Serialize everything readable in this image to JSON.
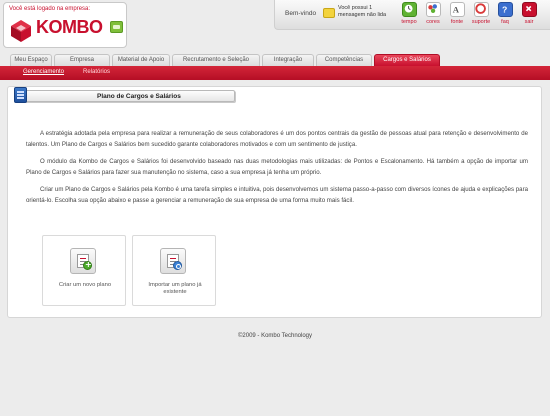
{
  "header": {
    "tagline": "Você está logado na empresa:",
    "brand": "KOMBO",
    "welcome": "Bem-vindo",
    "messages": "Você possui 1 mensagem não lida",
    "tools": [
      {
        "label": "tempo",
        "icon": "clock-icon",
        "color": "#5fb233"
      },
      {
        "label": "cores",
        "icon": "palette-icon",
        "color": "#d93a3a"
      },
      {
        "label": "fonte",
        "icon": "font-icon",
        "color": "#8a8a8a"
      },
      {
        "label": "suporte",
        "icon": "support-icon",
        "color": "#d93a3a"
      },
      {
        "label": "faq",
        "icon": "faq-icon",
        "color": "#3b6fcf"
      },
      {
        "label": "sair",
        "icon": "exit-icon",
        "color": "#c8102e"
      }
    ]
  },
  "nav": {
    "tabs": [
      {
        "label": "Meu Espaço"
      },
      {
        "label": "Empresa"
      },
      {
        "label": "Material de Apoio"
      },
      {
        "label": "Recrutamento e Seleção"
      },
      {
        "label": "Integração"
      },
      {
        "label": "Competências"
      },
      {
        "label": "Cargos e Salários",
        "active": true
      }
    ],
    "subnav": [
      "Gerenciamento",
      "Relatórios"
    ]
  },
  "panel": {
    "title": "Plano de Cargos e Salários",
    "paragraphs": [
      "A estratégia adotada pela empresa para realizar a remuneração de seus colaboradores é um dos pontos centrais da gestão de pessoas atual para retenção e desenvolvimento de talentos. Um Plano de Cargos e Salários bem sucedido garante colaboradores motivados e com um sentimento de justiça.",
      "O módulo da Kombo de Cargos e Salários foi desenvolvido baseado nas duas metodologias mais utilizadas: de Pontos e Escalonamento. Há também a opção de importar um Plano de Cargos e Salários para fazer sua manutenção no sistema, caso a sua empresa já tenha um próprio.",
      "Criar um Plano de Cargos e Salários pela Kombo é uma tarefa simples e intuitiva, pois desenvolvemos um sistema passo-a-passo com diversos ícones de ajuda e explicações para orientá-lo. Escolha sua opção abaixo e passe a gerenciar a remuneração de sua empresa de uma forma muito mais fácil."
    ],
    "options": [
      {
        "label": "Criar um novo plano",
        "icon": "new-plan-icon"
      },
      {
        "label": "Importar um plano já existente",
        "icon": "import-plan-icon"
      }
    ]
  },
  "footer": {
    "text": "©2009 - Kombo Technology"
  },
  "colors": {
    "accent": "#c8102e",
    "background": "#ececec"
  }
}
